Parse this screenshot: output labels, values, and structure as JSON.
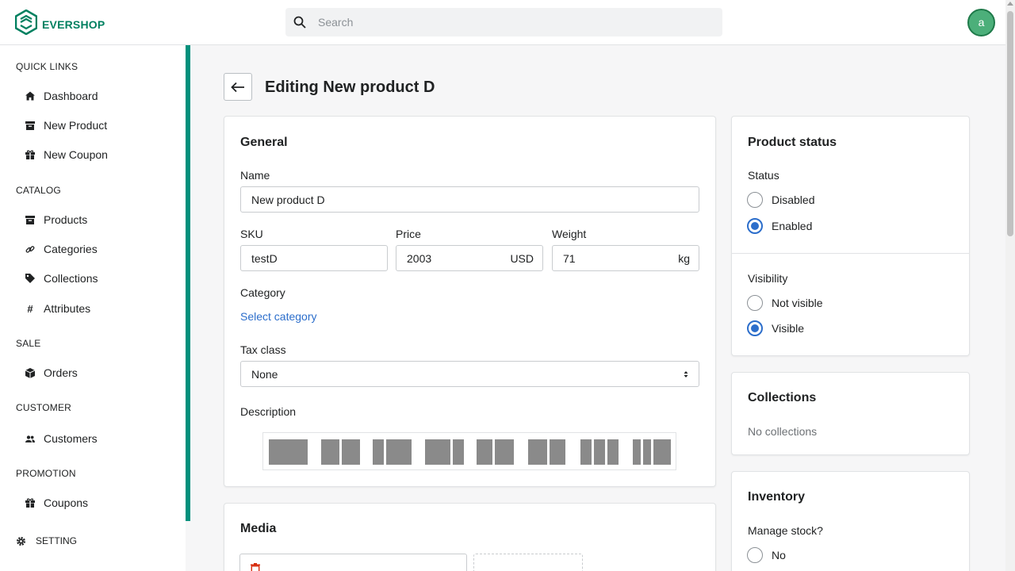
{
  "brand": {
    "name": "EVERSHOP",
    "accent": "#008060"
  },
  "search": {
    "placeholder": "Search"
  },
  "user": {
    "avatar_initial": "a"
  },
  "sidebar": {
    "quick_links": {
      "title": "QUICK LINKS",
      "items": [
        "Dashboard",
        "New Product",
        "New Coupon"
      ]
    },
    "catalog": {
      "title": "CATALOG",
      "items": [
        "Products",
        "Categories",
        "Collections",
        "Attributes"
      ]
    },
    "sale": {
      "title": "SALE",
      "items": [
        "Orders"
      ]
    },
    "customer": {
      "title": "CUSTOMER",
      "items": [
        "Customers"
      ]
    },
    "promotion": {
      "title": "PROMOTION",
      "items": [
        "Coupons"
      ]
    },
    "setting": {
      "title": "SETTING"
    }
  },
  "page": {
    "title": "Editing New product D"
  },
  "general": {
    "title": "General",
    "name_label": "Name",
    "name_value": "New product D",
    "sku_label": "SKU",
    "sku_value": "testD",
    "price_label": "Price",
    "price_value": "2003",
    "price_currency": "USD",
    "weight_label": "Weight",
    "weight_value": "71",
    "weight_unit": "kg",
    "category_label": "Category",
    "category_link": "Select category",
    "tax_label": "Tax class",
    "tax_value": "None",
    "description_label": "Description"
  },
  "media": {
    "title": "Media"
  },
  "product_status": {
    "title": "Product status",
    "status_label": "Status",
    "status_options": [
      "Disabled",
      "Enabled"
    ],
    "status_selected": "Enabled",
    "visibility_label": "Visibility",
    "visibility_options": [
      "Not visible",
      "Visible"
    ],
    "visibility_selected": "Visible"
  },
  "collections": {
    "title": "Collections",
    "empty_text": "No collections"
  },
  "inventory": {
    "title": "Inventory",
    "manage_stock_label": "Manage stock?",
    "manage_stock_options": [
      "No"
    ]
  },
  "colors": {
    "accent_blue": "#2c6ecb",
    "sidebar_bar": "#00907c",
    "avatar_bg": "#4caf7a"
  }
}
